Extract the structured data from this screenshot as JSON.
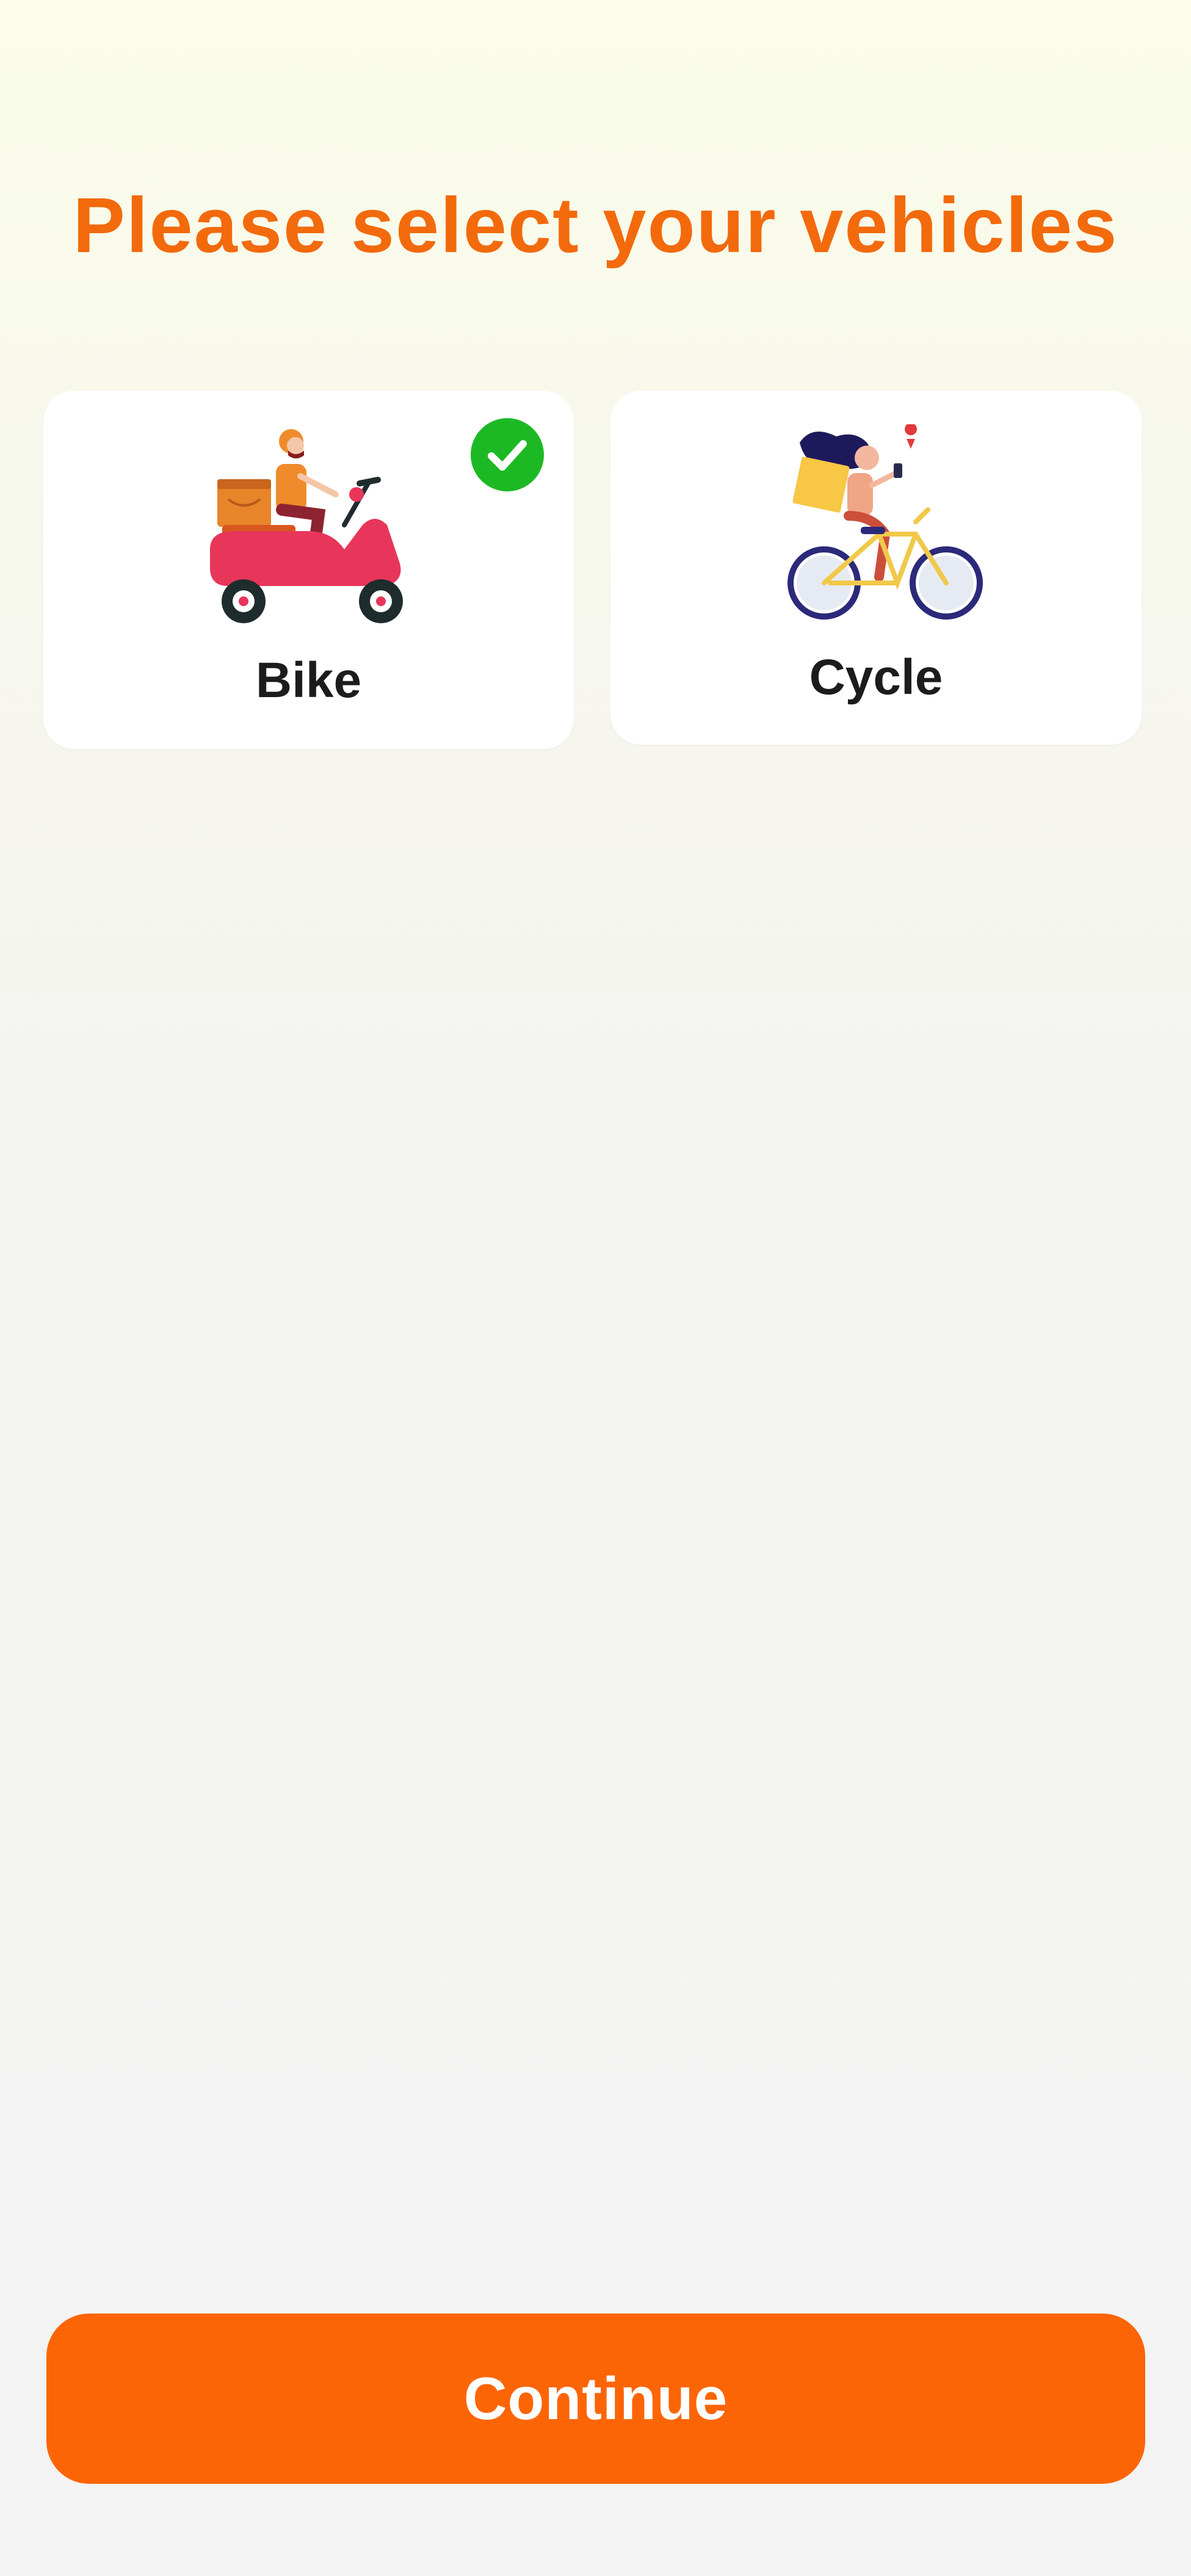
{
  "page": {
    "title": "Please select your vehicles"
  },
  "vehicles": [
    {
      "label": "Bike",
      "icon": "scooter-delivery-illustration",
      "selected": true
    },
    {
      "label": "Cycle",
      "icon": "bicycle-delivery-illustration",
      "selected": false
    }
  ],
  "selected_badge_icon": "check-circle-icon",
  "actions": {
    "continue_label": "Continue"
  },
  "colors": {
    "title": "#f26a0c",
    "primary_button": "#fc6506",
    "check_badge": "#1db924",
    "card_background": "#ffffff",
    "label_text": "#1c1c1c"
  }
}
